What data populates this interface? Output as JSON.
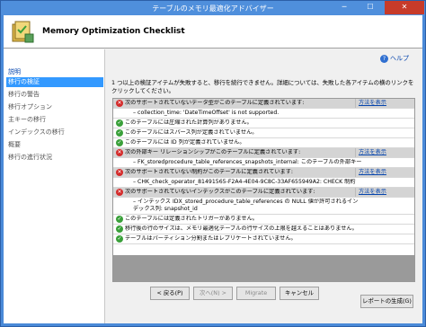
{
  "window": {
    "title": "テーブルのメモリ最適化アドバイザー",
    "minimize": "─",
    "maximize": "☐",
    "close": "✕"
  },
  "header": {
    "title": "Memory Optimization Checklist"
  },
  "sidebar": {
    "items": [
      {
        "label": "説明",
        "state": "link"
      },
      {
        "label": "移行の検証",
        "state": "selected"
      },
      {
        "label": "移行の警告",
        "state": "inactive"
      },
      {
        "label": "移行オプション",
        "state": "inactive"
      },
      {
        "label": "主キーの移行",
        "state": "inactive"
      },
      {
        "label": "インデックスの移行",
        "state": "inactive"
      },
      {
        "label": "概要",
        "state": "inactive"
      },
      {
        "label": "移行の進行状況",
        "state": "inactive"
      }
    ]
  },
  "main": {
    "help_label": "ヘルプ",
    "intro": "1 つ以上の検証アイテムが失敗すると、移行を続行できません。詳細については、失敗した各アイテムの横のリンクをクリックしてください。",
    "rows": [
      {
        "status": "fail",
        "text": "次のサポートされていないデータ型がこのテーブルに定義されています:",
        "link": "方法を表示"
      },
      {
        "status": "detail",
        "text": "– collection_time: 'DateTimeOffset' is not supported.",
        "link": ""
      },
      {
        "status": "ok",
        "text": "このテーブルには圧縮された計算列がありません。",
        "link": ""
      },
      {
        "status": "ok",
        "text": "このテーブルにはスパース列が定義されていません。",
        "link": ""
      },
      {
        "status": "ok",
        "text": "このテーブルには ID 列が定義されていません。",
        "link": ""
      },
      {
        "status": "fail",
        "text": "次の外部キー リレーションシップがこのテーブルに定義されています:",
        "link": "方法を表示"
      },
      {
        "status": "detail",
        "text": "– FK_storedprocedure_table_references_snapshots_internal: このテーブルの外部キー",
        "link": ""
      },
      {
        "status": "fail",
        "text": "次のサポートされていない制約がこのテーブルに定義されています:",
        "link": "方法を表示"
      },
      {
        "status": "detail",
        "text": "– CHK_check_operator_81491565-F2A4-4E04-9C8C-33AF655949A2: CHECK 制約",
        "link": ""
      },
      {
        "status": "fail",
        "text": "次のサポートされていないインデックスがこのテーブルに定義されています:",
        "link": "方法を表示"
      },
      {
        "status": "detail",
        "text": "– インデックス IDX_stored_procedure_table_references の NULL 値が許可されるインデックス列: snapshot_id",
        "link": ""
      },
      {
        "status": "ok",
        "text": "このテーブルには定義されたトリガーがありません。",
        "link": ""
      },
      {
        "status": "ok",
        "text": "移行後の行のサイズは、メモリ最適化テーブルの行サイズの上限を越えることはありません。",
        "link": ""
      },
      {
        "status": "ok",
        "text": "テーブルはパーティション分割またはレプリケートされていません。",
        "link": ""
      }
    ],
    "report_button": "レポートの生成(G)"
  },
  "footer": {
    "back": "< 戻る(P)",
    "next": "次へ(N) >",
    "migrate": "Migrate",
    "cancel": "キャンセル"
  },
  "colors": {
    "title_bar": "#4f8fdc",
    "close_button": "#c73b2a",
    "selected_item": "#3399ff",
    "link": "#0645ad",
    "ok_icon": "#3aa03a",
    "error_icon": "#d42a2a",
    "fail_row": "#d4d4d4"
  }
}
